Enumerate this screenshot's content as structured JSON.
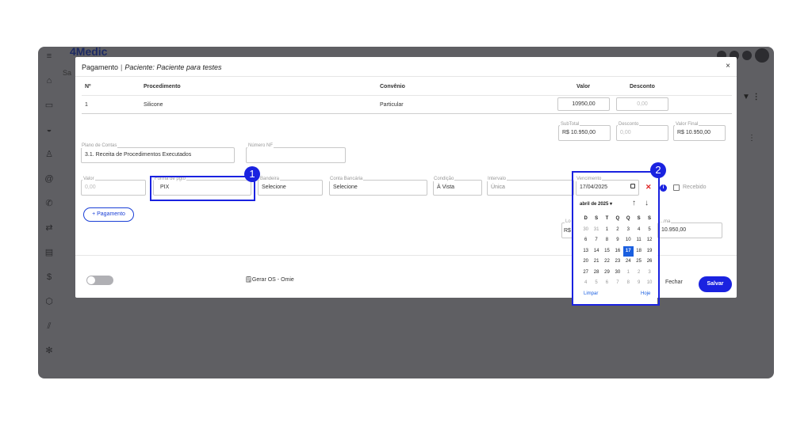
{
  "app": {
    "logo": "4Medic",
    "side_label": "Sa",
    "sidebar_icons": [
      "menu-icon",
      "home-icon",
      "calendar-icon",
      "car-icon",
      "person-icon",
      "at-icon",
      "phone-icon",
      "swap-icon",
      "clipboard-icon",
      "dollar-icon",
      "box-icon",
      "chart-icon",
      "gear-icon"
    ]
  },
  "modal": {
    "title": "Pagamento",
    "separator": "|",
    "patient": "Paciente: Paciente para testes",
    "close": "×"
  },
  "table": {
    "headers": {
      "num": "Nº",
      "procedimento": "Procedimento",
      "convenio": "Convênio",
      "valor": "Valor",
      "desconto": "Desconto"
    },
    "row": {
      "num": "1",
      "procedimento": "Silicone",
      "convenio": "Particular",
      "valor": "10950,00",
      "desconto": "0,00"
    }
  },
  "totals": {
    "subtotal_label": "SubTotal",
    "subtotal": "R$ 10.950,00",
    "desconto_label": "Desconto",
    "desconto": "0,00",
    "final_label": "Valor Final",
    "final": "R$ 10.950,00"
  },
  "plano": {
    "label": "Plano de Contas",
    "value": "3.1. Receita de Procedimentos Executados"
  },
  "nf": {
    "label": "Número NF",
    "value": ""
  },
  "payment": {
    "valor_label": "Valor",
    "valor": "0,00",
    "forma_label": "Forma de pgto",
    "forma": "PIX",
    "bandeira_label": "Bandeira",
    "bandeira": "Selecione",
    "conta_label": "Conta Bancária",
    "conta": "Selecione",
    "condicao_label": "Condição",
    "condicao": "À Vista",
    "intervalo_label": "Intervalo",
    "intervalo": "Única",
    "vencimento_label": "Vencimento",
    "vencimento": "17/04/2025",
    "clear_icon": "✕",
    "recebido_label": "Recebido",
    "partial_label": "Lo",
    "partial_value": "R$",
    "partial_right_label": "...ma",
    "partial_right_value": "10.950,00"
  },
  "buttons": {
    "add_payment": "+ Pagamento",
    "omie": "Gerar OS - Omie",
    "fechar": "Fechar",
    "salvar": "Salvar"
  },
  "callouts": {
    "one": "1",
    "two": "2"
  },
  "calendar": {
    "month": "abril de 2025 ▾",
    "weekdays": [
      "D",
      "S",
      "T",
      "Q",
      "Q",
      "S",
      "S"
    ],
    "weeks": [
      [
        "30",
        "31",
        "1",
        "2",
        "3",
        "4",
        "5"
      ],
      [
        "6",
        "7",
        "8",
        "9",
        "10",
        "11",
        "12"
      ],
      [
        "13",
        "14",
        "15",
        "16",
        "17",
        "18",
        "19"
      ],
      [
        "20",
        "21",
        "22",
        "23",
        "24",
        "25",
        "26"
      ],
      [
        "27",
        "28",
        "29",
        "30",
        "1",
        "2",
        "3"
      ],
      [
        "4",
        "5",
        "6",
        "7",
        "8",
        "9",
        "10"
      ]
    ],
    "selected": "17",
    "clear": "Limpar",
    "today": "Hoje"
  },
  "colors": {
    "accent": "#1a22e0",
    "overlay": "#5f5f63"
  }
}
